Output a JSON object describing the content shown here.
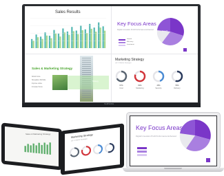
{
  "board": {
    "brand": "SAMSUNG",
    "sales_results": {
      "title": "Sales Results",
      "bars": [
        30,
        45,
        38,
        52,
        41,
        60,
        48,
        65,
        55,
        70,
        58,
        74,
        62,
        80,
        68,
        85,
        72
      ]
    },
    "key_focus": {
      "title": "Key Focus Areas",
      "subtitle": "Digital Innovation Profit Performance Enhanced",
      "pie_label": "Growth",
      "legend": [
        {
          "label": "Growth",
          "color": "#7a36c8"
        },
        {
          "label": "Efficiency",
          "color": "#a97fe0"
        },
        {
          "label": "Investment",
          "color": "#d9c8f2"
        }
      ]
    },
    "sales_marketing": {
      "title": "Sales & Marketing Strategy",
      "bullets": [
        "Attract more",
        "Strengthen Portfolio",
        "Improve online",
        "Increase Focus"
      ],
      "band_text": "Strategy"
    },
    "marketing": {
      "title": "Marketing Strategy",
      "subtitle": "Q3 / 4 Market Strategies",
      "rings": [
        {
          "label": "Cost",
          "value": "67%",
          "pct": 0.67,
          "color": "#5a6572"
        },
        {
          "label": "Marketing",
          "value": "80%",
          "pct": 0.8,
          "color": "#d2343a"
        },
        {
          "label": "Security",
          "value": "45%",
          "pct": 0.45,
          "color": "#4a8bd4"
        },
        {
          "label": "Delivery",
          "value": "55%",
          "pct": 0.55,
          "color": "#2a3a5c"
        }
      ]
    }
  },
  "tablet_left": {
    "title": "Sales & Marketing Strategy",
    "bars": [
      40,
      55,
      48,
      62,
      52,
      70,
      58,
      75,
      64,
      80
    ]
  },
  "tablet_mid": {
    "title": "Marketing Strategy",
    "subtitle": "Q3 / 4 Market Strategies",
    "rings": [
      {
        "pct": 0.67,
        "color": "#5a6572"
      },
      {
        "pct": 0.8,
        "color": "#d2343a"
      },
      {
        "pct": 0.45,
        "color": "#4a8bd4"
      },
      {
        "pct": 0.55,
        "color": "#2a3a5c"
      }
    ]
  },
  "laptop": {
    "title": "Key Focus Areas",
    "subtitle": "Digital Innovation Profit Performance Enhanced",
    "legend_colors": [
      "#7a36c8",
      "#a97fe0",
      "#d9c8f2"
    ]
  }
}
